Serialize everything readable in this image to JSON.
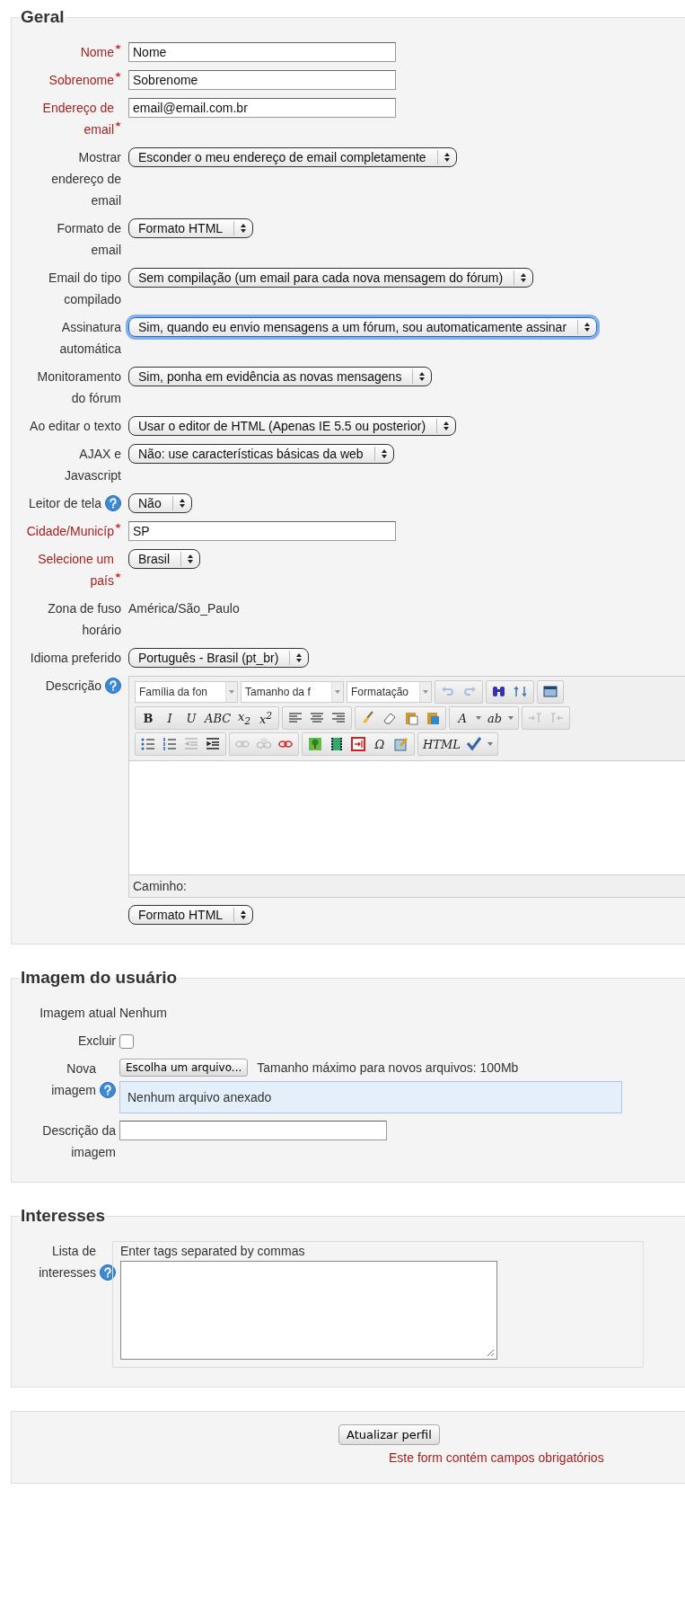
{
  "sections": [
    {
      "legend": "Geral",
      "fields": [
        {
          "kind": "text",
          "label": "Nome",
          "required": true,
          "value": "Nome"
        },
        {
          "kind": "text",
          "label": "Sobrenome",
          "required": true,
          "value": "Sobrenome"
        },
        {
          "kind": "text",
          "label": "Endereço de email",
          "required": true,
          "value": "email@email.com.br"
        },
        {
          "kind": "select",
          "label": "Mostrar endereço de email",
          "required": false,
          "value": "Esconder o meu endereço de email completamente",
          "focused": false
        },
        {
          "kind": "select",
          "label": "Formato de email",
          "required": false,
          "value": "Formato HTML",
          "focused": false
        },
        {
          "kind": "select",
          "label": "Email do tipo compilado",
          "required": false,
          "value": "Sem compilação (um email para cada nova mensagem do fórum)",
          "focused": false
        },
        {
          "kind": "select",
          "label": "Assinatura automática",
          "required": false,
          "value": "Sim, quando eu envio mensagens a um fórum, sou automaticamente assinar",
          "focused": true
        },
        {
          "kind": "select",
          "label": "Monitoramento do fórum",
          "required": false,
          "value": "Sim, ponha em evidência as novas mensagens",
          "focused": false
        },
        {
          "kind": "select",
          "label": "Ao editar o texto",
          "required": false,
          "value": "Usar o editor de HTML (Apenas IE 5.5 ou posterior)",
          "focused": false
        },
        {
          "kind": "select",
          "label": "AJAX e Javascript",
          "required": false,
          "value": "Não: use características básicas da web",
          "focused": false
        },
        {
          "kind": "select",
          "label": "Leitor de tela",
          "required": false,
          "help": true,
          "value": "Não",
          "focused": false
        },
        {
          "kind": "text",
          "label": "Cidade/Municíp",
          "required": true,
          "value": "SP"
        },
        {
          "kind": "select",
          "label": "Selecione um país",
          "required": true,
          "value": "Brasil",
          "focused": false
        },
        {
          "kind": "static",
          "label": "Zona de fuso horário",
          "required": false,
          "value": "América/São_Paulo"
        },
        {
          "kind": "select",
          "label": "Idioma preferido",
          "required": false,
          "value": "Português - Brasil (pt_br)",
          "focused": false
        },
        {
          "kind": "editor",
          "label": "Descrição",
          "required": false,
          "help": true,
          "toolbar": [
            [
              {
                "kind": "combo",
                "label": "Família da fon"
              },
              {
                "kind": "combo",
                "label": "Tamanho da f"
              },
              {
                "kind": "combo",
                "label": "Formatação"
              },
              {
                "kind": "group",
                "buttons": [
                  {
                    "disabled": true
                  },
                  {
                    "disabled": true
                  }
                ]
              },
              {
                "kind": "group",
                "buttons": [
                  {
                    "disabled": false
                  },
                  {
                    "disabled": false
                  }
                ]
              },
              {
                "kind": "group",
                "buttons": [
                  {
                    "disabled": false
                  }
                ]
              }
            ],
            [
              {
                "kind": "group",
                "buttons": [
                  {
                    "label": "B",
                    "disabled": false
                  },
                  {
                    "label": "I",
                    "disabled": false
                  },
                  {
                    "label": "U",
                    "disabled": false
                  },
                  {
                    "label": "ABC",
                    "disabled": false
                  },
                  {
                    "label": "x$_{2}$",
                    "disabled": false
                  },
                  {
                    "label": "x$^{2}$",
                    "disabled": false
                  }
                ]
              },
              {
                "kind": "group",
                "buttons": [
                  {
                    "disabled": false
                  },
                  {
                    "disabled": false
                  },
                  {
                    "disabled": false
                  }
                ]
              },
              {
                "kind": "group",
                "buttons": [
                  {
                    "disabled": false
                  },
                  {
                    "disabled": false
                  },
                  {
                    "disabled": false
                  },
                  {
                    "disabled": false
                  }
                ]
              },
              {
                "kind": "group",
                "buttons": [
                  {
                    "label": "A",
                    "split": true,
                    "disabled": false
                  },
                  {
                    "label": "ab",
                    "split": true,
                    "disabled": false
                  }
                ]
              },
              {
                "kind": "group",
                "buttons": [
                  {
                    "disabled": true
                  },
                  {
                    "disabled": true
                  }
                ]
              }
            ],
            [
              {
                "kind": "group",
                "buttons": [
                  {
                    "disabled": false
                  },
                  {
                    "disabled": false
                  },
                  {
                    "disabled": true
                  },
                  {
                    "disabled": false
                  }
                ]
              },
              {
                "kind": "group",
                "buttons": [
                  {
                    "disabled": true
                  },
                  {
                    "disabled": true
                  },
                  {
                    "disabled": false
                  }
                ]
              },
              {
                "kind": "group",
                "buttons": [
                  {
                    "disabled": false
                  },
                  {
                    "disabled": false
                  },
                  {
                    "disabled": false
                  },
                  {
                    "label": "Ω",
                    "disabled": false
                  },
                  {
                    "disabled": false
                  }
                ]
              },
              {
                "kind": "group",
                "buttons": [
                  {
                    "label": "HTML",
                    "disabled": false
                  },
                  {
                    "split": true,
                    "disabled": false
                  }
                ]
              }
            ]
          ],
          "path_label": "Caminho:",
          "format": "Formato HTML"
        }
      ]
    },
    {
      "legend": "Imagem do usuário",
      "fields": [
        {
          "kind": "static",
          "label": "Imagem atual",
          "required": false,
          "value": "Nenhum"
        },
        {
          "kind": "checkbox",
          "label": "Excluir",
          "required": false,
          "checked": false
        },
        {
          "kind": "file",
          "label": "Nova imagem",
          "required": false,
          "help": true,
          "button": "Escolha um arquivo...",
          "note": "Tamanho máximo para novos arquivos: 100Mb",
          "files": "Nenhum arquivo anexado"
        },
        {
          "kind": "text",
          "label": "Descrição da imagem",
          "required": false
        }
      ]
    },
    {
      "legend": "Interesses",
      "fields": [
        {
          "kind": "tags",
          "label": "Lista de interesses",
          "required": false,
          "help": true,
          "hint": "Enter tags separated by commas"
        }
      ]
    }
  ],
  "submit": {
    "button": "Atualizar perfil",
    "note": "Este form contém campos obrigatórios"
  }
}
